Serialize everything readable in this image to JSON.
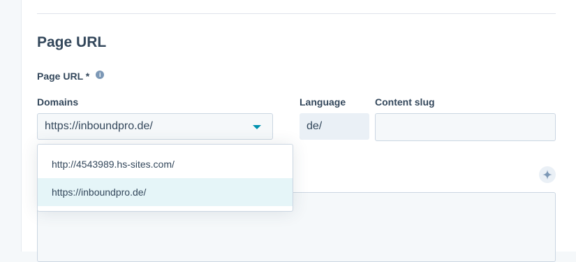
{
  "section": {
    "title": "Page URL"
  },
  "page_url": {
    "label": "Page URL *",
    "info_icon": "info-icon"
  },
  "domains": {
    "label": "Domains",
    "selected": "https://inboundpro.de/",
    "options": [
      {
        "label": "http://4543989.hs-sites.com/",
        "selected": false
      },
      {
        "label": "https://inboundpro.de/",
        "selected": true
      }
    ]
  },
  "language": {
    "label": "Language",
    "value": "de/"
  },
  "content_slug": {
    "label": "Content slug",
    "value": ""
  },
  "colors": {
    "accent": "#0091ae",
    "text": "#33475b",
    "selected_bg": "#e5f5f8"
  }
}
